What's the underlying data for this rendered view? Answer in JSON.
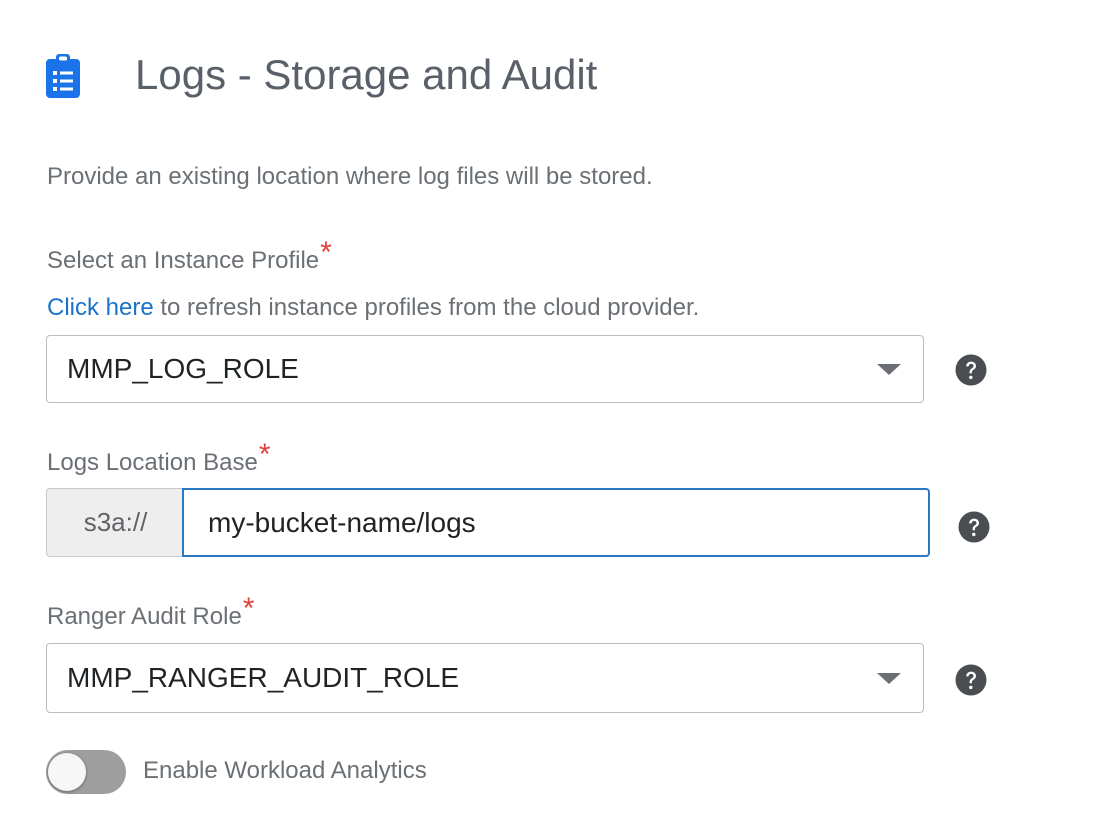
{
  "header": {
    "title": "Logs - Storage and Audit",
    "icon": "clipboard-list-icon",
    "icon_color": "#1a73e8"
  },
  "description": "Provide an existing location where log files will be stored.",
  "instance_profile": {
    "label": "Select an Instance Profile",
    "required_mark": "*",
    "refresh_link": "Click here",
    "refresh_text": " to refresh instance profiles from the cloud provider.",
    "selected": "MMP_LOG_ROLE",
    "help_icon": "question-circle-icon"
  },
  "logs_location": {
    "label": "Logs Location Base",
    "required_mark": "*",
    "prefix": "s3a://",
    "value": "my-bucket-name/logs",
    "help_icon": "question-circle-icon"
  },
  "ranger_audit": {
    "label": "Ranger Audit Role",
    "required_mark": "*",
    "selected": "MMP_RANGER_AUDIT_ROLE",
    "help_icon": "question-circle-icon"
  },
  "workload_analytics": {
    "label": "Enable Workload Analytics",
    "enabled": false
  },
  "colors": {
    "link": "#1a73c8",
    "required": "#e0413c",
    "input_focus_border": "#2b78c5",
    "toggle_off": "#9e9e9e"
  }
}
